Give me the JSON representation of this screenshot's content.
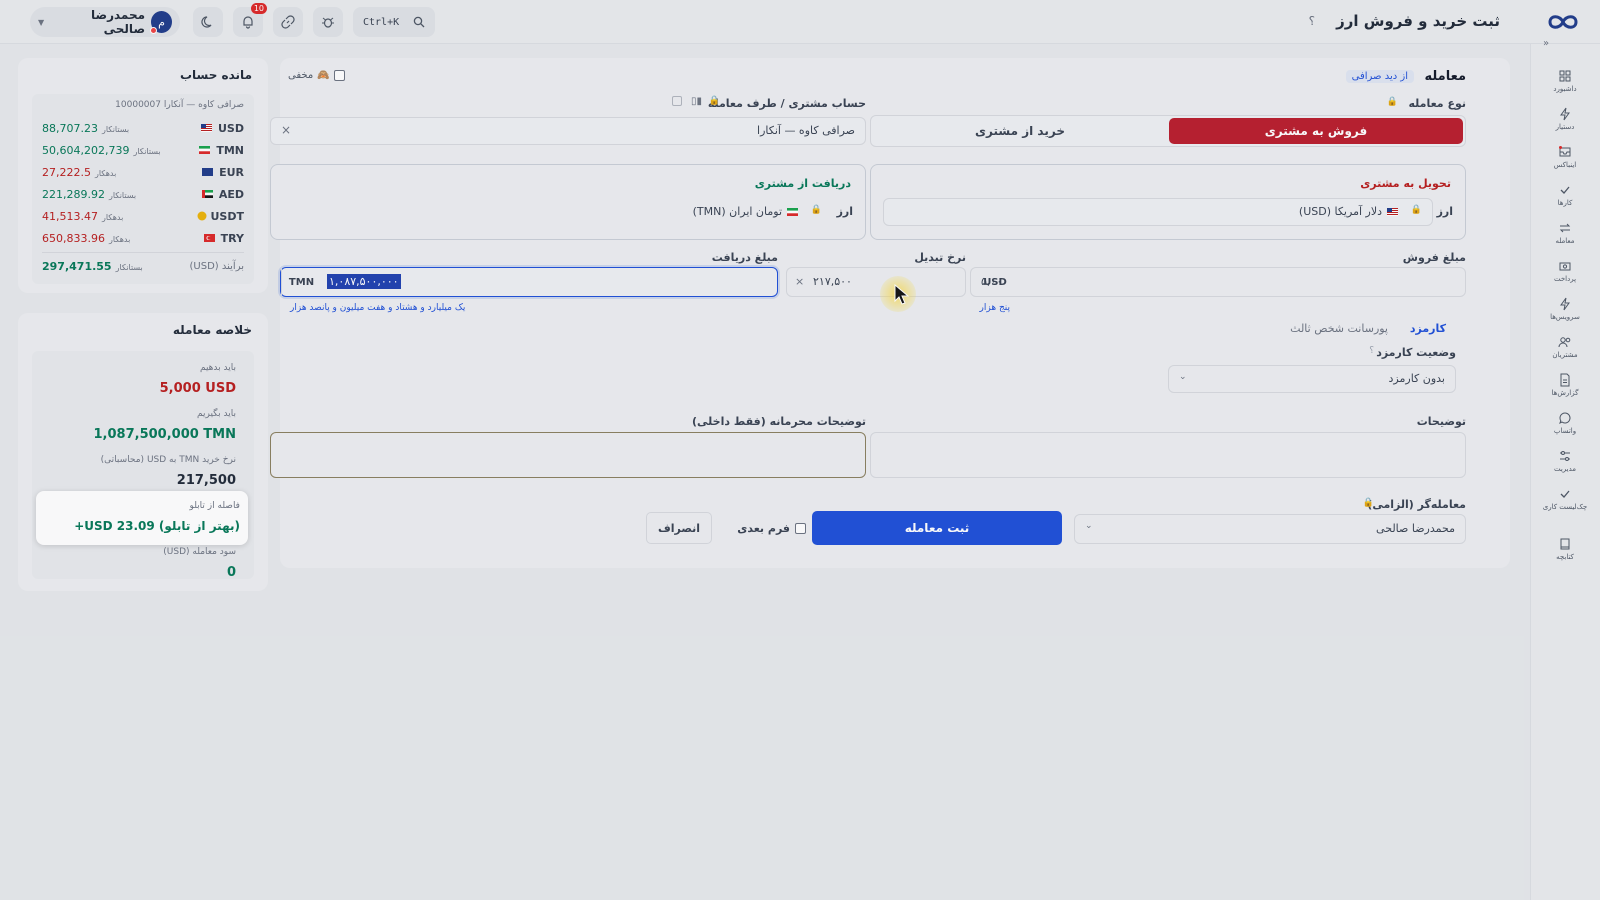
{
  "header": {
    "title": "ثبت خرید و فروش ارز",
    "help": "؟",
    "user_name": "محمدرضا صالحی",
    "user_initial": "م",
    "notifications_count": "10",
    "search_shortcut": "Ctrl+K"
  },
  "nav": {
    "items": [
      {
        "label": "داشبورد",
        "icon": "dashboard-icon"
      },
      {
        "label": "دستیار",
        "icon": "bolt-icon"
      },
      {
        "label": "اینباکس",
        "icon": "inbox-icon"
      },
      {
        "label": "کارها",
        "icon": "check-icon"
      },
      {
        "label": "معامله",
        "icon": "exchange-icon"
      },
      {
        "label": "پرداخت",
        "icon": "payment-icon"
      },
      {
        "label": "سرویس‌ها",
        "icon": "services-icon"
      },
      {
        "label": "مشتریان",
        "icon": "users-icon"
      },
      {
        "label": "گزارش‌ها",
        "icon": "report-icon"
      },
      {
        "label": "واتساپ",
        "icon": "chat-icon"
      },
      {
        "label": "مدیریت",
        "icon": "settings-icon"
      },
      {
        "label": "چک‌لیست کاری",
        "icon": "checklist-icon"
      },
      {
        "label": "کتابچه",
        "icon": "book-icon"
      }
    ]
  },
  "form": {
    "section_title": "معامله",
    "section_subtitle": "از دید صرافی",
    "hidden_label": "مخفی",
    "trade_type_label": "نوع معامله",
    "sell_label": "فروش به مشتری",
    "buy_label": "خرید از مشتری",
    "account_label": "حساب مشتری / طرف معامله",
    "account_value": "صرافی کاوه — آنکارا",
    "deliver_title": "تحویل به مشتری",
    "deliver_currency_label": "ارز",
    "deliver_currency_value": "دلار آمریکا (USD)",
    "receive_title": "دریافت از مشتری",
    "receive_currency_label": "ارز",
    "receive_currency_value": "تومان ایران (TMN)",
    "sell_amount_label": "مبلغ فروش",
    "sell_amount_value": "۵,۰۰۰",
    "sell_amount_currency": "USD",
    "sell_amount_words": "پنج هزار",
    "rate_label": "نرخ تبدیل",
    "rate_value": "۲۱۷,۵۰۰",
    "rate_op": "×",
    "receive_amount_label": "مبلغ دریافت",
    "receive_amount_value": "۱,۰۸۷,۵۰۰,۰۰۰",
    "receive_amount_currency": "TMN",
    "receive_amount_words": "یک میلیارد و هشتاد و هفت میلیون و پانصد هزار",
    "fee_tab": "کارمزد",
    "commission_tab": "پورسانت شخص ثالث",
    "fee_status_label": "وضعیت کارمزد",
    "fee_status_help": "؟",
    "fee_status_value": "بدون کارمزد",
    "notes_label": "توضیحات",
    "private_notes_label": "توضیحات محرمانه (فقط داخلی)",
    "trader_label": "معامله‌گر (الزامی)",
    "trader_value": "محمدرضا صالحی",
    "submit_label": "ثبت معامله",
    "next_form_label": "فرم بعدی",
    "cancel_label": "انصراف"
  },
  "balance": {
    "title": "مانده حساب",
    "account": "صرافی کاوه — آنکارا 10000007",
    "rows": [
      {
        "currency": "USD",
        "value": "88,707.23",
        "tag": "بستانکار",
        "status": "credit"
      },
      {
        "currency": "TMN",
        "value": "50,604,202,739",
        "tag": "بستانکار",
        "status": "credit"
      },
      {
        "currency": "EUR",
        "value": "27,222.5",
        "tag": "بدهکار",
        "status": "debit"
      },
      {
        "currency": "AED",
        "value": "221,289.92",
        "tag": "بستانکار",
        "status": "credit"
      },
      {
        "currency": "USDT",
        "value": "41,513.47",
        "tag": "بدهکار",
        "status": "debit"
      },
      {
        "currency": "TRY",
        "value": "650,833.96",
        "tag": "بدهکار",
        "status": "debit"
      }
    ],
    "total_label": "برآیند (USD)",
    "total_value": "297,471.55",
    "total_tag": "بستانکار"
  },
  "summary": {
    "title": "خلاصه معامله",
    "pay_label": "باید بدهیم",
    "pay_value": "5,000 USD",
    "get_label": "باید بگیریم",
    "get_value": "1,087,500,000 TMN",
    "rate_label": "نرخ خرید TMN به USD (محاسباتی)",
    "rate_value": "217,500",
    "board_label": "فاصله از تابلو",
    "board_value": "(بهتر از تابلو) USD 23.09+",
    "profit_label": "سود معامله (USD)",
    "profit_value": "0"
  },
  "colors": {
    "sell_accent": "#b91c2c",
    "primary": "#1d4ed8",
    "credit": "#047857",
    "debit": "#b91c1c"
  }
}
